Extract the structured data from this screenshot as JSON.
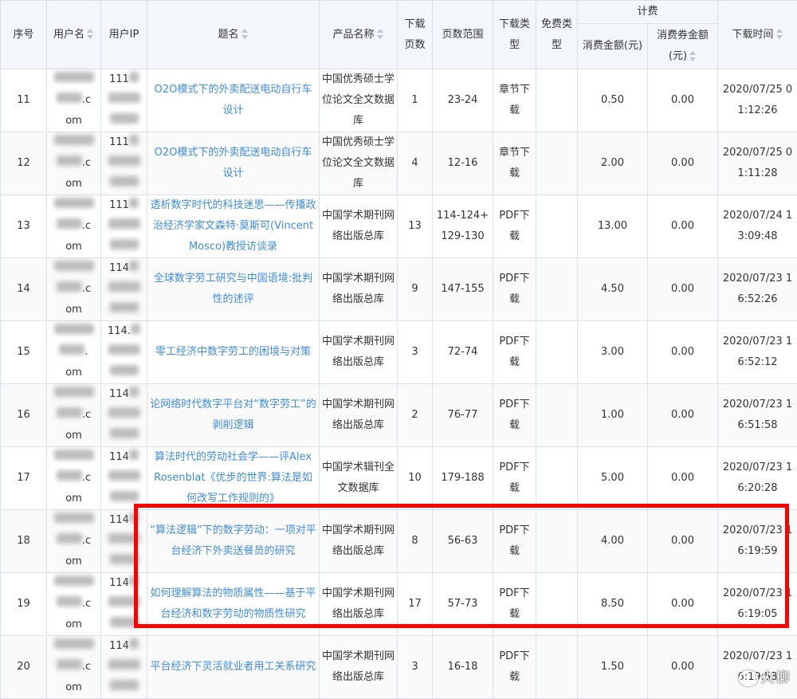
{
  "columns": {
    "index": "序号",
    "username": "用户名",
    "ip": "用户IP",
    "title": "题名",
    "product": "产品名称",
    "pages": "下载页数",
    "page_range": "页数范围",
    "download_type": "下载类型",
    "free_type": "免费类型",
    "billing_group": "计费",
    "amount": "消费金额(元)",
    "coupon": "消费券金额(元)",
    "time": "下载时间"
  },
  "rows": [
    {
      "index": "11",
      "user_mid": "c",
      "user_end": "om",
      "ip": "111",
      "title": "O2O模式下的外卖配送电动自行车设计",
      "product": "中国优秀硕士学位论文全文数据库",
      "pages": "1",
      "range": "23-24",
      "dltype": "章节下载",
      "free": "",
      "amount": "0.50",
      "coupon": "0.00",
      "time": "2020/07/25 01:12:26"
    },
    {
      "index": "12",
      "user_mid": "c",
      "user_end": "om",
      "ip": "111",
      "title": "O2O模式下的外卖配送电动自行车设计",
      "product": "中国优秀硕士学位论文全文数据库",
      "pages": "4",
      "range": "12-16",
      "dltype": "章节下载",
      "free": "",
      "amount": "2.00",
      "coupon": "0.00",
      "time": "2020/07/25 01:11:28"
    },
    {
      "index": "13",
      "user_mid": "c",
      "user_end": "om",
      "ip": "111",
      "title": "透析数字时代的科技迷思——传播政治经济学家文森特·莫斯可(Vincent Mosco)教授访谈录",
      "product": "中国学术期刊网络出版总库",
      "pages": "13",
      "range": "114-124+129-130",
      "dltype": "PDF下载",
      "free": "",
      "amount": "13.00",
      "coupon": "0.00",
      "time": "2020/07/24 13:09:48"
    },
    {
      "index": "14",
      "user_mid": "c",
      "user_end": "om",
      "ip": "114",
      "title": "全球数字劳工研究与中国语境:批判性的述评",
      "product": "中国学术期刊网络出版总库",
      "pages": "9",
      "range": "147-155",
      "dltype": "PDF下载",
      "free": "",
      "amount": "4.50",
      "coupon": "0.00",
      "time": "2020/07/23 16:52:26"
    },
    {
      "index": "15",
      "user_mid": "",
      "user_end": "om",
      "ip": "114.",
      "title": "零工经济中数字劳工的困境与对策",
      "product": "中国学术期刊网络出版总库",
      "pages": "3",
      "range": "72-74",
      "dltype": "PDF下载",
      "free": "",
      "amount": "3.00",
      "coupon": "0.00",
      "time": "2020/07/23 16:52:12"
    },
    {
      "index": "16",
      "user_mid": "c",
      "user_end": "om",
      "ip": "114",
      "title": "论网络时代数字平台对“数字劳工”的剥削逻辑",
      "product": "中国学术期刊网络出版总库",
      "pages": "2",
      "range": "76-77",
      "dltype": "PDF下载",
      "free": "",
      "amount": "1.00",
      "coupon": "0.00",
      "time": "2020/07/23 16:51:58"
    },
    {
      "index": "17",
      "user_mid": "c",
      "user_end": "om",
      "ip": "114",
      "title": "算法时代的劳动社会学——评Alex Rosenblat《优步的世界:算法是如何改写工作规则的》",
      "product": "中国学术辑刊全文数据库",
      "pages": "10",
      "range": "179-188",
      "dltype": "PDF下载",
      "free": "",
      "amount": "5.00",
      "coupon": "0.00",
      "time": "2020/07/23 16:20:28"
    },
    {
      "index": "18",
      "user_mid": "c",
      "user_end": "om",
      "ip": "114",
      "title": "“算法逻辑”下的数字劳动：一项对平台经济下外卖送餐员的研究",
      "product": "中国学术期刊网络出版总库",
      "pages": "8",
      "range": "56-63",
      "dltype": "PDF下载",
      "free": "",
      "amount": "4.00",
      "coupon": "0.00",
      "time": "2020/07/23 16:19:59"
    },
    {
      "index": "19",
      "user_mid": "c",
      "user_end": "om",
      "ip": "114",
      "title": "如何理解算法的物质属性——基于平台经济和数字劳动的物质性研究",
      "product": "中国学术期刊网络出版总库",
      "pages": "17",
      "range": "57-73",
      "dltype": "PDF下载",
      "free": "",
      "amount": "8.50",
      "coupon": "0.00",
      "time": "2020/07/23 16:19:05"
    },
    {
      "index": "20",
      "user_mid": "c",
      "user_end": "om",
      "ip": "114",
      "title": "平台经济下灵活就业者用工关系研究",
      "product": "中国学术期刊网络出版总库",
      "pages": "3",
      "range": "16-18",
      "dltype": "PDF下载",
      "free": "",
      "amount": "1.50",
      "coupon": "0.00",
      "time": "2020/07/23 16:19:53"
    }
  ],
  "watermark": "火柳"
}
